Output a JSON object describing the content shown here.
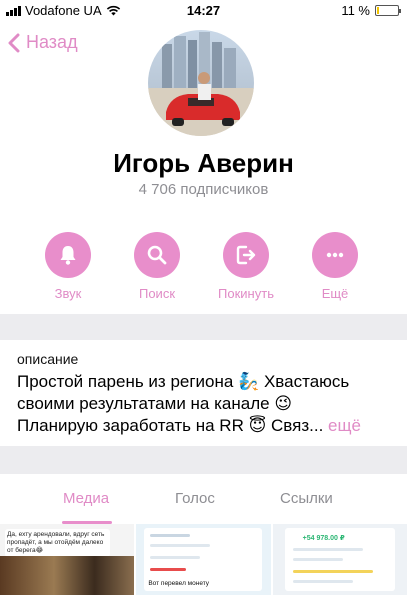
{
  "status_bar": {
    "carrier": "Vodafone UA",
    "time": "14:27",
    "battery_percent": "11 %",
    "battery_level": 0.11,
    "battery_color": "#f2c400"
  },
  "nav": {
    "back_label": "Назад",
    "back_icon": "chevron-left-icon"
  },
  "channel": {
    "name": "Игорь Аверин",
    "subscribers": "4 706 подписчиков"
  },
  "actions": [
    {
      "label": "Звук",
      "icon": "bell-icon"
    },
    {
      "label": "Поиск",
      "icon": "search-icon"
    },
    {
      "label": "Покинуть",
      "icon": "leave-icon"
    },
    {
      "label": "Ещё",
      "icon": "more-icon"
    }
  ],
  "description": {
    "label": "описание",
    "line1": "Простой парень из региона 🧞 Хвастаюсь",
    "line2": "своими результатами на канале 😉",
    "line3": "Планирую заработать на RR 😇 Связ...",
    "more": "ещё"
  },
  "tabs": [
    {
      "label": "Медиа",
      "active": true
    },
    {
      "label": "Голос",
      "active": false
    },
    {
      "label": "Ссылки",
      "active": false
    }
  ],
  "media": {
    "thumb1_text": "Да, ехту арендовали, вдруг сеть пропадёт, а мы отойдём далеко от берега😂",
    "thumb2_text": "Вот перевел монету",
    "thumb3_amount": "+54 978.00 ₽"
  },
  "colors": {
    "accent": "#e08bc6",
    "accent_button": "#e88ecb",
    "secondary_text": "#8e8e93",
    "separator": "#ececef"
  }
}
